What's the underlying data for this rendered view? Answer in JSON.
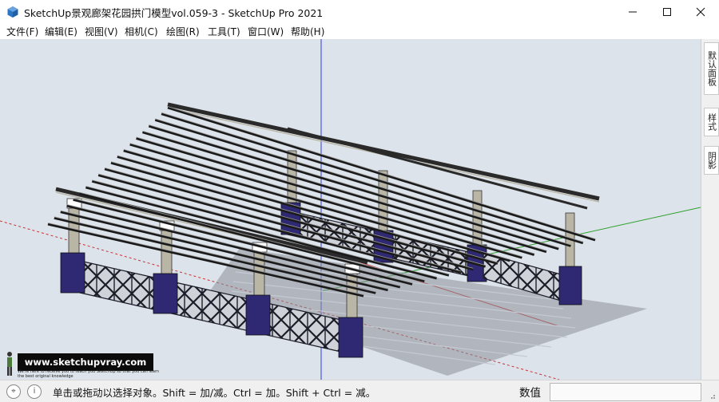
{
  "window": {
    "title": "SketchUp景观廊架花园拱门模型vol.059-3 - SketchUp Pro 2021",
    "controls": {
      "minimize": "─",
      "maximize": "☐",
      "close": "✕"
    }
  },
  "menu": [
    {
      "label": "文件(F)"
    },
    {
      "label": "编辑(E)"
    },
    {
      "label": "视图(V)"
    },
    {
      "label": "相机(C)"
    },
    {
      "label": "绘图(R)"
    },
    {
      "label": "工具(T)"
    },
    {
      "label": "窗口(W)"
    },
    {
      "label": "帮助(H)"
    }
  ],
  "right_panel": {
    "tabs": [
      {
        "label": "默认面板"
      },
      {
        "label": "样式"
      },
      {
        "label": "阴影"
      }
    ]
  },
  "watermark": {
    "site": "www.sketchupvray.com",
    "note": "We're here to receive you to teach you SketchUp so that you can learn the best original knowledge"
  },
  "status": {
    "message": "单击或拖动以选择对象。Shift = 加/减。Ctrl = 加。Shift + Ctrl = 减。",
    "measurements_label": "数值",
    "measurements_value": ""
  },
  "icons": [
    "app-icon",
    "geo-location-icon",
    "info-icon",
    "person-icon",
    "resize-grip-icon"
  ],
  "colors": {
    "viewport_bg": "#dde3ea",
    "axis_red": "#c83232",
    "axis_green": "#2ea02e",
    "axis_blue": "#2d3ce0",
    "pedestal": "#2f2872",
    "column": "#b9b6a6",
    "rafter": "#1a1a1a"
  }
}
